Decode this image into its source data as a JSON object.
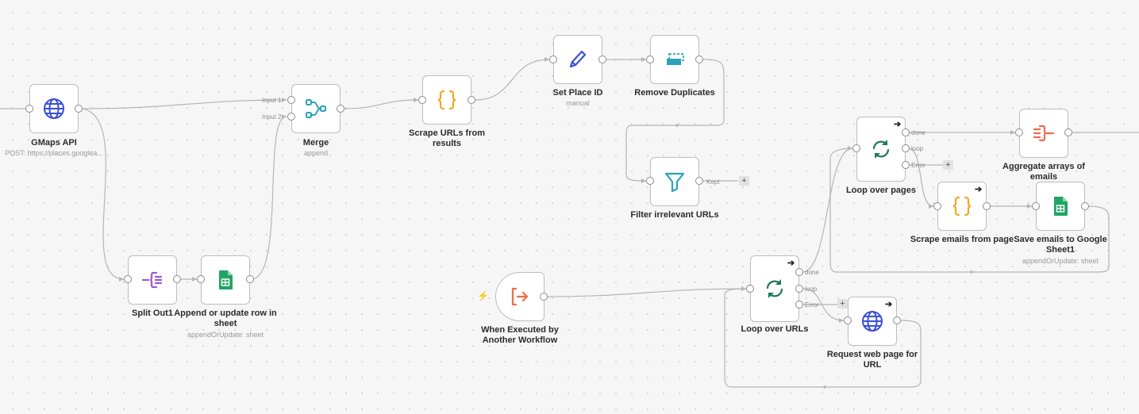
{
  "nodes": {
    "gmaps": {
      "title": "GMaps API",
      "subtitle": "POST: https://places.googlea..."
    },
    "merge": {
      "title": "Merge",
      "subtitle": "append",
      "input1": "Input 1",
      "input2": "Input 2"
    },
    "scrape_urls": {
      "title_line1": "Scrape URLs from",
      "title_line2": "results"
    },
    "set_place": {
      "title": "Set Place ID",
      "subtitle": "manual"
    },
    "remove_dup": {
      "title": "Remove Duplicates"
    },
    "filter": {
      "title": "Filter irrelevant URLs",
      "port": "Kept"
    },
    "split_out": {
      "title": "Split Out1"
    },
    "append_row": {
      "title_line1": "Append or update row in",
      "title_line2": "sheet",
      "subtitle": "appendOrUpdate: sheet"
    },
    "trigger": {
      "title_line1": "When Executed by",
      "title_line2": "Another Workflow"
    },
    "loop_urls": {
      "title": "Loop over URLs",
      "done": "done",
      "loop": "loop",
      "error": "Error"
    },
    "request_page": {
      "title_line1": "Request web page for",
      "title_line2": "URL"
    },
    "loop_pages": {
      "title": "Loop over pages",
      "done": "done",
      "loop": "loop",
      "error": "Error"
    },
    "aggregate": {
      "title_line1": "Aggregate arrays of",
      "title_line2": "emails"
    },
    "scrape_emails": {
      "title": "Scrape emails from page"
    },
    "save_emails": {
      "title_line1": "Save emails to Google",
      "title_line2": "Sheet1",
      "subtitle": "appendOrUpdate: sheet"
    }
  },
  "icons": {
    "http": "globe-icon",
    "merge": "merge-icon",
    "code": "curly-braces-icon",
    "set": "pencil-icon",
    "dedupe": "remove-duplicates-icon",
    "filter": "funnel-icon",
    "split": "split-out-icon",
    "sheets": "google-sheets-icon",
    "trigger": "execute-workflow-trigger-icon",
    "loop": "loop-icon",
    "aggregate": "aggregate-icon"
  },
  "colors": {
    "globe": "#3b4fd8",
    "merge": "#2aa3b8",
    "code": "#f5a623",
    "pencil": "#3b4fd8",
    "dedupe": "#2aa3b8",
    "filter": "#2aa3b8",
    "split": "#9b59d0",
    "sheets": "#21a464",
    "trigger": "#ef6b4a",
    "loop": "#1f7a5a",
    "aggregate": "#ef6b4a",
    "edge": "#b5b5b5"
  },
  "misc": {
    "plus": "+",
    "arrow": "➔",
    "bolt": "⚡"
  }
}
